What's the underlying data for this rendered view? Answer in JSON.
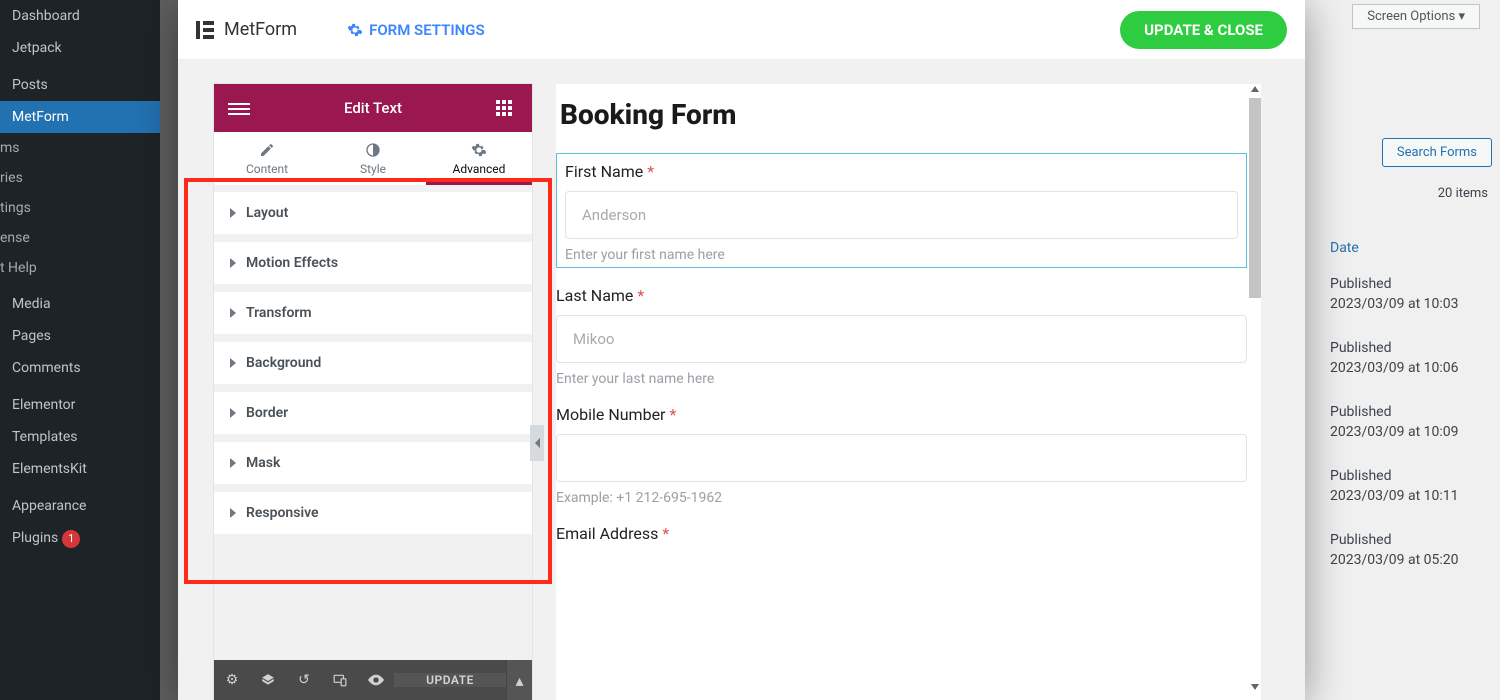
{
  "wp": {
    "items": [
      "Dashboard",
      "Jetpack",
      "Posts",
      "MetForm",
      "ms",
      "ries",
      "tings",
      "ense",
      "t Help",
      "Media",
      "Pages",
      "Comments",
      "Elementor",
      "Templates",
      "ElementsKit",
      "Appearance",
      "Plugins"
    ],
    "active_index": 3,
    "plugins_badge": "1"
  },
  "topbar": {
    "screen_options": "Screen Options ▾",
    "search": "Search Forms",
    "items_count": "20 items",
    "date_header": "Date",
    "published": [
      {
        "status": "Published",
        "date": "2023/03/09 at 10:03"
      },
      {
        "status": "Published",
        "date": "2023/03/09 at 10:06"
      },
      {
        "status": "Published",
        "date": "2023/03/09 at 10:09"
      },
      {
        "status": "Published",
        "date": "2023/03/09 at 10:11"
      },
      {
        "status": "Published",
        "date": "2023/03/09 at 05:20"
      }
    ]
  },
  "modal": {
    "logo_text": "MetForm",
    "settings_label": "FORM SETTINGS",
    "update_close": "UPDATE & CLOSE"
  },
  "elementor": {
    "panel_title": "Edit Text",
    "tabs": {
      "content": "Content",
      "style": "Style",
      "advanced": "Advanced",
      "active": "advanced"
    },
    "sections": [
      "Layout",
      "Motion Effects",
      "Transform",
      "Background",
      "Border",
      "Mask",
      "Responsive"
    ],
    "footer_update": "UPDATE"
  },
  "form": {
    "title": "Booking Form",
    "fields": [
      {
        "label": "First Name",
        "required": true,
        "placeholder": "Anderson",
        "help": "Enter your first name here",
        "selected": true
      },
      {
        "label": "Last Name",
        "required": true,
        "placeholder": "Mikoo",
        "help": "Enter your last name here",
        "selected": false
      },
      {
        "label": "Mobile Number",
        "required": true,
        "placeholder": "",
        "help": "Example: +1 212-695-1962",
        "selected": false
      },
      {
        "label": "Email Address",
        "required": true,
        "placeholder": "",
        "help": "",
        "selected": false
      }
    ]
  }
}
